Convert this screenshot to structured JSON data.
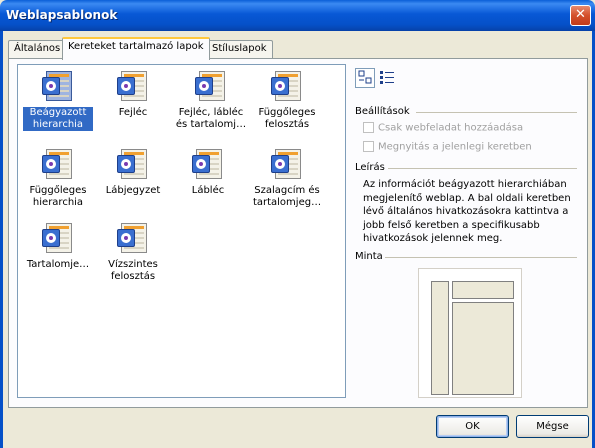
{
  "window": {
    "title": "Weblapsablonok",
    "close_glyph": "✕"
  },
  "tabs": [
    {
      "label": "Általános",
      "active": false
    },
    {
      "label": "Kereteket tartalmazó lapok",
      "active": true
    },
    {
      "label": "Stíluslapok",
      "active": false
    }
  ],
  "templates": [
    {
      "label": "Beágyazott hierarchia",
      "selected": true,
      "icon": "frames-page-icon"
    },
    {
      "label": "Fejléc",
      "selected": false,
      "icon": "frames-page-icon"
    },
    {
      "label": "Fejléc, lábléc és tartalomj…",
      "selected": false,
      "icon": "frames-page-icon"
    },
    {
      "label": "Függőleges felosztás",
      "selected": false,
      "icon": "frames-page-icon"
    },
    {
      "label": "Függőleges hierarchia",
      "selected": false,
      "icon": "frames-page-icon"
    },
    {
      "label": "Lábjegyzet",
      "selected": false,
      "icon": "frames-page-icon"
    },
    {
      "label": "Lábléc",
      "selected": false,
      "icon": "frames-page-icon"
    },
    {
      "label": "Szalagcím és tartalomjeg…",
      "selected": false,
      "icon": "frames-page-icon"
    },
    {
      "label": "Tartalomje…",
      "selected": false,
      "icon": "frames-page-icon"
    },
    {
      "label": "Vízszintes felosztás",
      "selected": false,
      "icon": "frames-page-icon"
    }
  ],
  "view_buttons": {
    "large_icons": "large-icons-view-icon",
    "list": "list-view-icon"
  },
  "settings": {
    "heading": "Beállítások",
    "option1": "Csak webfeladat hozzáadása",
    "option2": "Megnyitás a jelenlegi keretben"
  },
  "description": {
    "heading": "Leírás",
    "text": "Az információt beágyazott hierarchiában megjelenítő weblap. A bal oldali keretben lévő általános hivatkozásokra kattintva a jobb felső keretben a specifikusabb hivatkozások jelennek meg."
  },
  "preview": {
    "heading": "Minta"
  },
  "buttons": {
    "ok": "OK",
    "cancel": "Mégse"
  },
  "colors": {
    "titlebar": "#0550c8",
    "selection": "#316ac5",
    "dialog_bg": "#ece9d8"
  }
}
